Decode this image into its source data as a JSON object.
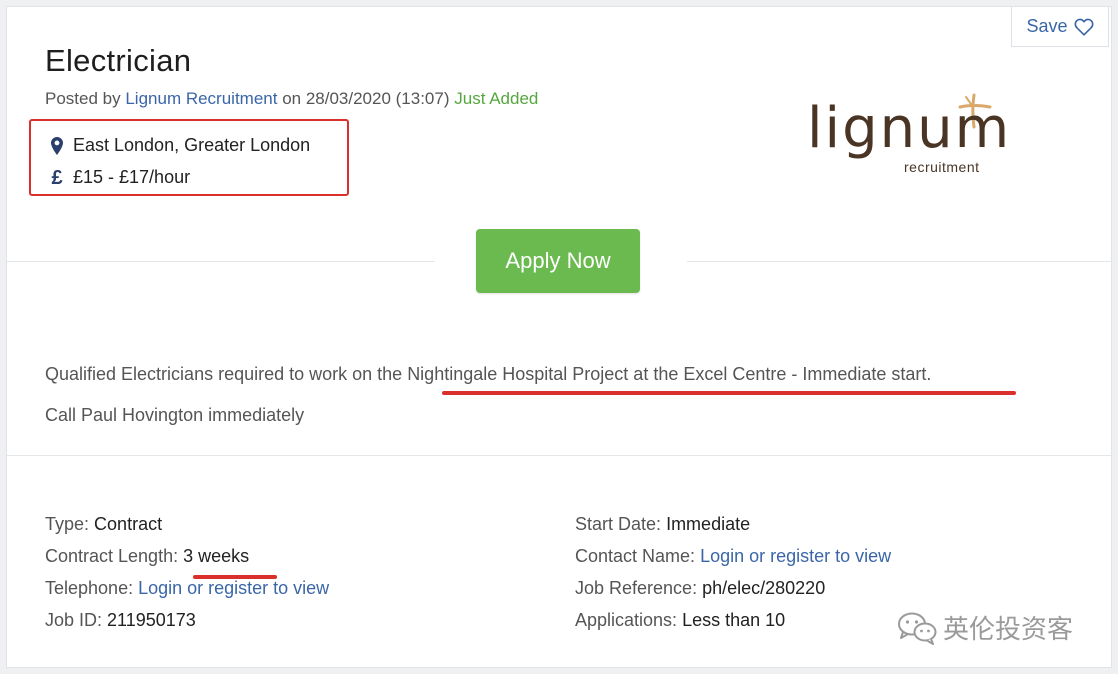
{
  "job": {
    "title": "Electrician",
    "posted_by_prefix": "Posted by",
    "company": "Lignum Recruitment",
    "posted_on": "on 28/03/2020 (13:07)",
    "status": "Just Added",
    "location": "East London, Greater London",
    "salary": "£15 - £17/hour",
    "currency_symbol": "£"
  },
  "actions": {
    "save_label": "Save",
    "apply_label": "Apply Now"
  },
  "logo": {
    "word": "lignum",
    "sub": "recruitment"
  },
  "description": {
    "line1_prefix": "Qualified Electricians required to work on the ",
    "line1_highlight": "Nightingale Hospital Project at the Excel Centre - Immediate start.",
    "line2": "Call Paul Hovington immediately"
  },
  "details_left": [
    {
      "label": "Type:",
      "value": "Contract",
      "is_link": false
    },
    {
      "label": "Contract Length:",
      "value": "3 weeks",
      "is_link": false
    },
    {
      "label": "Telephone:",
      "value": "Login or register to view",
      "is_link": true
    },
    {
      "label": "Job ID:",
      "value": "211950173",
      "is_link": false
    }
  ],
  "details_right": [
    {
      "label": "Start Date:",
      "value": "Immediate",
      "is_link": false
    },
    {
      "label": "Contact Name:",
      "value": "Login or register to view",
      "is_link": true
    },
    {
      "label": "Job Reference:",
      "value": "ph/elec/280220",
      "is_link": false
    },
    {
      "label": "Applications:",
      "value": "Less than 10",
      "is_link": false
    }
  ],
  "watermark": {
    "text": "英伦投资客",
    "icon": "wechat-icon"
  },
  "colors": {
    "accent_blue": "#3a66a8",
    "apply_green": "#6bba50",
    "status_green": "#56a73f",
    "annotation_red": "#d9302c",
    "logo_brown": "#4a3424",
    "logo_gold": "#d9a86a"
  },
  "icons": {
    "location": "map-marker-icon",
    "salary": "pound-icon",
    "save": "heart-icon"
  }
}
